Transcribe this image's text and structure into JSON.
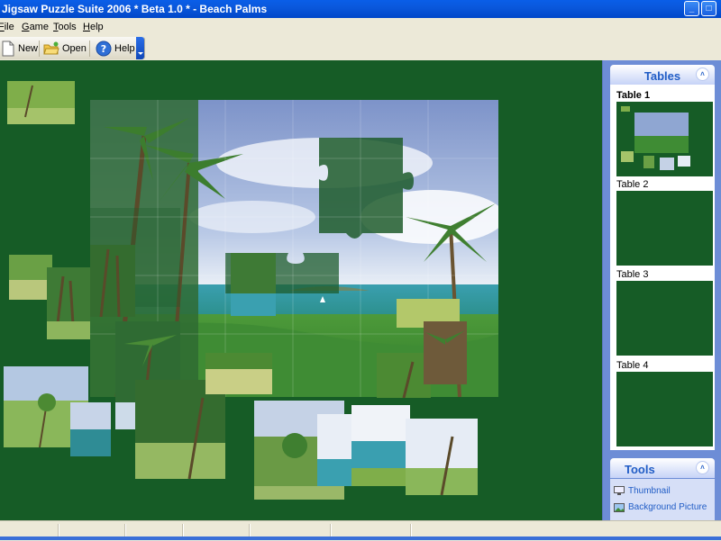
{
  "window": {
    "title": "Jigsaw Puzzle Suite 2006 * Beta 1.0 * - Beach Palms"
  },
  "menu": [
    "File",
    "Game",
    "Tools",
    "Help"
  ],
  "toolbar": {
    "new_label": "New",
    "open_label": "Open",
    "help_label": "Help"
  },
  "tables_panel": {
    "title": "Tables",
    "items": [
      {
        "label": "Table 1",
        "active": true
      },
      {
        "label": "Table 2",
        "active": false
      },
      {
        "label": "Table 3",
        "active": false
      },
      {
        "label": "Table 4",
        "active": false
      }
    ]
  },
  "tools_panel": {
    "title": "Tools",
    "items": [
      {
        "label": "Thumbnail",
        "icon": "monitor-icon"
      },
      {
        "label": "Background Picture",
        "icon": "picture-icon"
      }
    ]
  },
  "colors": {
    "table_green": "#165c26",
    "titlebar_blue": "#0a5ee8",
    "pane_blue": "#6d8dd6",
    "link_blue": "#215dc6"
  }
}
